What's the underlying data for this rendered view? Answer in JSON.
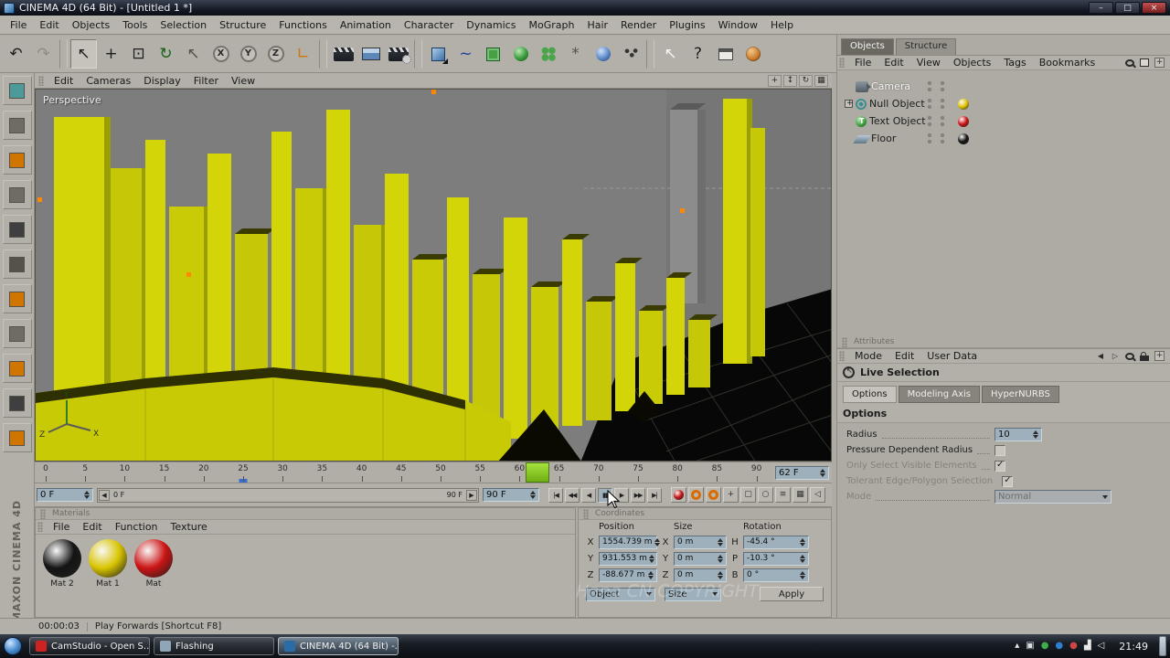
{
  "window": {
    "title": "CINEMA 4D (64 Bit) - [Untitled 1 *]",
    "controls": [
      {
        "name": "minimize-button",
        "glyph": "–"
      },
      {
        "name": "maximize-button",
        "glyph": "□"
      },
      {
        "name": "close-button",
        "glyph": "×",
        "close": true
      }
    ]
  },
  "menubar": {
    "items": [
      "File",
      "Edit",
      "Objects",
      "Tools",
      "Selection",
      "Structure",
      "Functions",
      "Animation",
      "Character",
      "Dynamics",
      "MoGraph",
      "Hair",
      "Render",
      "Plugins",
      "Window",
      "Help"
    ]
  },
  "toolbar": {
    "icons": [
      {
        "name": "undo-button",
        "kind": "glyph",
        "glyph": "↶",
        "color": "#1d1d1d"
      },
      {
        "name": "redo-button",
        "kind": "glyph",
        "glyph": "↷",
        "color": "#8f8c85"
      },
      {
        "name": "toolbar-separator",
        "kind": "sep"
      },
      {
        "name": "live-selection-button",
        "kind": "glyph",
        "glyph": "↖",
        "color": "#1d1d1d",
        "pressed": true
      },
      {
        "name": "move-tool-button",
        "kind": "glyph",
        "glyph": "+",
        "color": "#1d1d1d"
      },
      {
        "name": "scale-tool-button",
        "kind": "glyph",
        "glyph": "⊡",
        "color": "#1d1d1d"
      },
      {
        "name": "rotate-tool-button",
        "kind": "glyph",
        "glyph": "↻",
        "color": "#176117"
      },
      {
        "name": "last-tool-button",
        "kind": "glyph",
        "glyph": "↖",
        "color": "#55524c"
      },
      {
        "name": "lock-x-button",
        "kind": "letter",
        "glyph": "X"
      },
      {
        "name": "lock-y-button",
        "kind": "letter",
        "glyph": "Y"
      },
      {
        "name": "lock-z-button",
        "kind": "letter",
        "glyph": "Z"
      },
      {
        "name": "coord-system-button",
        "kind": "glyph",
        "glyph": "∟",
        "color": "#d07500"
      },
      {
        "name": "toolbar-separator",
        "kind": "sep"
      },
      {
        "name": "render-view-button",
        "kind": "clapper"
      },
      {
        "name": "render-picture-button",
        "kind": "picture"
      },
      {
        "name": "render-settings-button",
        "kind": "clappergear"
      },
      {
        "name": "toolbar-separator",
        "kind": "sep"
      },
      {
        "name": "add-cube-button",
        "kind": "cube"
      },
      {
        "name": "add-spline-button",
        "kind": "glyph",
        "glyph": "~",
        "color": "#20409a"
      },
      {
        "name": "add-nurbs-button",
        "kind": "greenbox"
      },
      {
        "name": "add-array-button",
        "kind": "greensphere"
      },
      {
        "name": "add-mograph-button",
        "kind": "greenflower"
      },
      {
        "name": "add-deformer-button",
        "kind": "glyph",
        "glyph": "*",
        "color": "#55524c"
      },
      {
        "name": "add-metaball-button",
        "kind": "blueblob"
      },
      {
        "name": "add-particles-button",
        "kind": "dots"
      },
      {
        "name": "toolbar-separator",
        "kind": "sep"
      },
      {
        "name": "pointer-tool-button",
        "kind": "glyph",
        "glyph": "↖",
        "color": "#f4f4f4"
      },
      {
        "name": "help-button",
        "kind": "glyph",
        "glyph": "?",
        "color": "#1d1d1d"
      },
      {
        "name": "content-browser-button",
        "kind": "table"
      },
      {
        "name": "online-help-globe-button",
        "kind": "globe"
      }
    ]
  },
  "left_toolbar": {
    "icons": [
      {
        "name": "make-editable-button",
        "accent": "#4d9a9a"
      },
      {
        "name": "model-mode-button",
        "accent": "#6f6c66"
      },
      {
        "name": "texture-mode-button",
        "accent": "#d07500"
      },
      {
        "name": "workplane-mode-button",
        "accent": "#6f6c66"
      },
      {
        "name": "points-mode-button",
        "accent": "#3f3f3f"
      },
      {
        "name": "edges-mode-button",
        "accent": "#55524c"
      },
      {
        "name": "polygons-mode-button",
        "accent": "#d07500"
      },
      {
        "name": "animation-mode-button",
        "accent": "#6f6c66"
      },
      {
        "name": "texture-axis-mode-button",
        "accent": "#d07500"
      },
      {
        "name": "object-axis-mode-button",
        "accent": "#3f3f3f"
      },
      {
        "name": "snap-settings-button",
        "accent": "#d07500"
      }
    ]
  },
  "viewport": {
    "label": "Perspective",
    "menu": [
      "Edit",
      "Cameras",
      "Display",
      "Filter",
      "View"
    ],
    "nav_icons": [
      {
        "name": "move-view-button",
        "glyph": "+"
      },
      {
        "name": "scale-view-button",
        "glyph": "↕"
      },
      {
        "name": "rotate-view-button",
        "glyph": "↻"
      },
      {
        "name": "toggle-views-button",
        "glyph": "▦"
      }
    ],
    "axis": {
      "x": "X",
      "y": "Y",
      "z": "Z"
    }
  },
  "timeline": {
    "ticks": [
      0,
      5,
      10,
      15,
      20,
      25,
      30,
      35,
      40,
      45,
      50,
      55,
      60,
      65,
      70,
      75,
      80,
      85,
      90
    ],
    "playhead_frame": 62,
    "marker_frame": 25,
    "current_frame": "62 F",
    "start_frame": "0 F",
    "end_frame": "90 F",
    "range_start": "0 F",
    "range_end": "90 F",
    "transport": [
      {
        "name": "goto-start-button",
        "glyph": "|◀"
      },
      {
        "name": "prev-key-button",
        "glyph": "◀◀"
      },
      {
        "name": "prev-frame-button",
        "glyph": "◀"
      },
      {
        "name": "pause-button",
        "glyph": "▮▮",
        "active": true
      },
      {
        "name": "next-frame-button",
        "glyph": "▶"
      },
      {
        "name": "next-key-button",
        "glyph": "▶▶"
      },
      {
        "name": "goto-end-button",
        "glyph": "▶|"
      }
    ],
    "record": [
      {
        "name": "record-button",
        "kind": "ball",
        "color": "#c41414"
      },
      {
        "name": "autokey-button",
        "kind": "ring",
        "color": "#d96c00"
      },
      {
        "name": "keyframe-button",
        "kind": "ring",
        "color": "#d96c00"
      },
      {
        "name": "record-position-button",
        "kind": "mini",
        "glyph": "+"
      },
      {
        "name": "record-scale-button",
        "kind": "mini",
        "glyph": "▢"
      },
      {
        "name": "record-rotation-button",
        "kind": "mini",
        "glyph": "○"
      },
      {
        "name": "record-parameter-button",
        "kind": "mini",
        "glyph": "≡"
      },
      {
        "name": "record-pla-button",
        "kind": "mini",
        "glyph": "▦"
      },
      {
        "name": "play-sound-button",
        "kind": "mini",
        "glyph": "◁"
      }
    ]
  },
  "materials": {
    "title": "Materials",
    "menu": [
      "File",
      "Edit",
      "Function",
      "Texture"
    ],
    "items": [
      {
        "label": "Mat 2",
        "color": "#141414"
      },
      {
        "label": "Mat 1",
        "color": "#d8c400"
      },
      {
        "label": "Mat",
        "color": "#cc1414"
      }
    ]
  },
  "coordinates": {
    "title": "Coordinates",
    "headers": [
      "Position",
      "Size",
      "Rotation"
    ],
    "rows": [
      {
        "pl": "X",
        "pv": "1554.739 m",
        "sl": "X",
        "sv": "0 m",
        "rl": "H",
        "rv": "-45.4 °"
      },
      {
        "pl": "Y",
        "pv": "931.553 m",
        "sl": "Y",
        "sv": "0 m",
        "rl": "P",
        "rv": "-10.3 °"
      },
      {
        "pl": "Z",
        "pv": "-88.677 m",
        "sl": "Z",
        "sv": "0 m",
        "rl": "B",
        "rv": "0 °"
      }
    ],
    "footer": {
      "left": "Object",
      "mid": "Size",
      "apply": "Apply"
    }
  },
  "objects_panel": {
    "tabs": [
      {
        "label": "Objects",
        "active": true
      },
      {
        "label": "Structure",
        "active": false
      }
    ],
    "menu": [
      "File",
      "Edit",
      "View",
      "Objects",
      "Tags",
      "Bookmarks"
    ],
    "icons": [
      {
        "name": "search-icon",
        "kind": "mag"
      },
      {
        "name": "layer-icon",
        "kind": "box"
      },
      {
        "name": "panel-menu-icon",
        "kind": "corner"
      }
    ],
    "tree": [
      {
        "label": "Camera",
        "icon": "camera-icon",
        "selected": true
      },
      {
        "label": "Null Object",
        "icon": "null-icon",
        "expander": true,
        "tag": "#e0c400"
      },
      {
        "label": "Text Object",
        "icon": "text-icon",
        "tag": "#cc1414"
      },
      {
        "label": "Floor",
        "icon": "floor-icon",
        "tag": "#141414"
      }
    ]
  },
  "attributes": {
    "title": "Attributes",
    "menu": [
      "Mode",
      "Edit",
      "User Data"
    ],
    "icons": [
      {
        "name": "history-back-icon",
        "kind": "glyph",
        "glyph": "◀"
      },
      {
        "name": "history-forward-icon",
        "kind": "glyph",
        "glyph": "▷"
      },
      {
        "name": "search-icon",
        "kind": "mag"
      },
      {
        "name": "lock-icon",
        "kind": "lock"
      },
      {
        "name": "panel-menu-icon",
        "kind": "corner"
      }
    ],
    "tool": "Live Selection",
    "tabs": [
      {
        "label": "Options",
        "active": true
      },
      {
        "label": "Modeling Axis",
        "active": false
      },
      {
        "label": "HyperNURBS",
        "active": false
      }
    ],
    "section": "Options",
    "radius": {
      "label": "Radius",
      "value": "10"
    },
    "checks": [
      {
        "label": "Pressure Dependent Radius",
        "checked": false,
        "dim": false
      },
      {
        "label": "Only Select Visible Elements",
        "checked": true,
        "dim": true
      },
      {
        "label": "Tolerant Edge/Polygon Selection",
        "checked": true,
        "dim": true
      }
    ],
    "mode": {
      "label": "Mode",
      "value": "Normal"
    }
  },
  "statusbar": {
    "time": "00:00:03",
    "message": "Play Forwards [Shortcut F8]"
  },
  "branding": {
    "text": "MAXON CINEMA 4D"
  },
  "watermark": {
    "text": "Hana CN COPYRIGHT"
  },
  "taskbar": {
    "buttons": [
      {
        "label": "CamStudio - Open S...",
        "color": "#cc2222",
        "active": false
      },
      {
        "label": "Flashing",
        "color": "#8fa6b8",
        "active": false
      },
      {
        "label": "CINEMA 4D (64 Bit) -...",
        "color": "#2a6ca8",
        "active": true
      }
    ],
    "tray": [
      {
        "name": "tray-show-hidden-icon",
        "glyph": "▴",
        "color": "#e8e8e8"
      },
      {
        "name": "tray-app-icon-1",
        "glyph": "▣",
        "color": "#d8dde2"
      },
      {
        "name": "tray-app-icon-2",
        "glyph": "●",
        "color": "#3fae49"
      },
      {
        "name": "tray-app-icon-3",
        "glyph": "●",
        "color": "#2f7fd0"
      },
      {
        "name": "tray-app-icon-4",
        "glyph": "●",
        "color": "#d04545"
      },
      {
        "name": "tray-network-icon",
        "glyph": "▟",
        "color": "#e8e8e8"
      },
      {
        "name": "tray-volume-icon",
        "glyph": "◁",
        "color": "#e8e8e8"
      }
    ],
    "clock": "21:49"
  }
}
